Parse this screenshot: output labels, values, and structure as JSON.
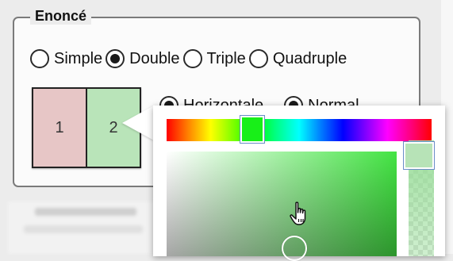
{
  "groupbox": {
    "title": "Enoncé"
  },
  "count_options": [
    {
      "label": "Simple",
      "checked": false
    },
    {
      "label": "Double",
      "checked": true
    },
    {
      "label": "Triple",
      "checked": false
    },
    {
      "label": "Quadruple",
      "checked": false
    }
  ],
  "orientation_options": [
    {
      "label": "Horizontale",
      "checked": true
    },
    {
      "label": "Normal",
      "checked": true
    }
  ],
  "swatches": [
    {
      "label": "1",
      "color": "#e7c6c6"
    },
    {
      "label": "2",
      "color": "#b9e4b9"
    }
  ],
  "color_picker": {
    "selected_hue_color": "#18ef18",
    "selected_color": "#b9e4b9",
    "cursor_icon": "hand-pointer-icon"
  }
}
